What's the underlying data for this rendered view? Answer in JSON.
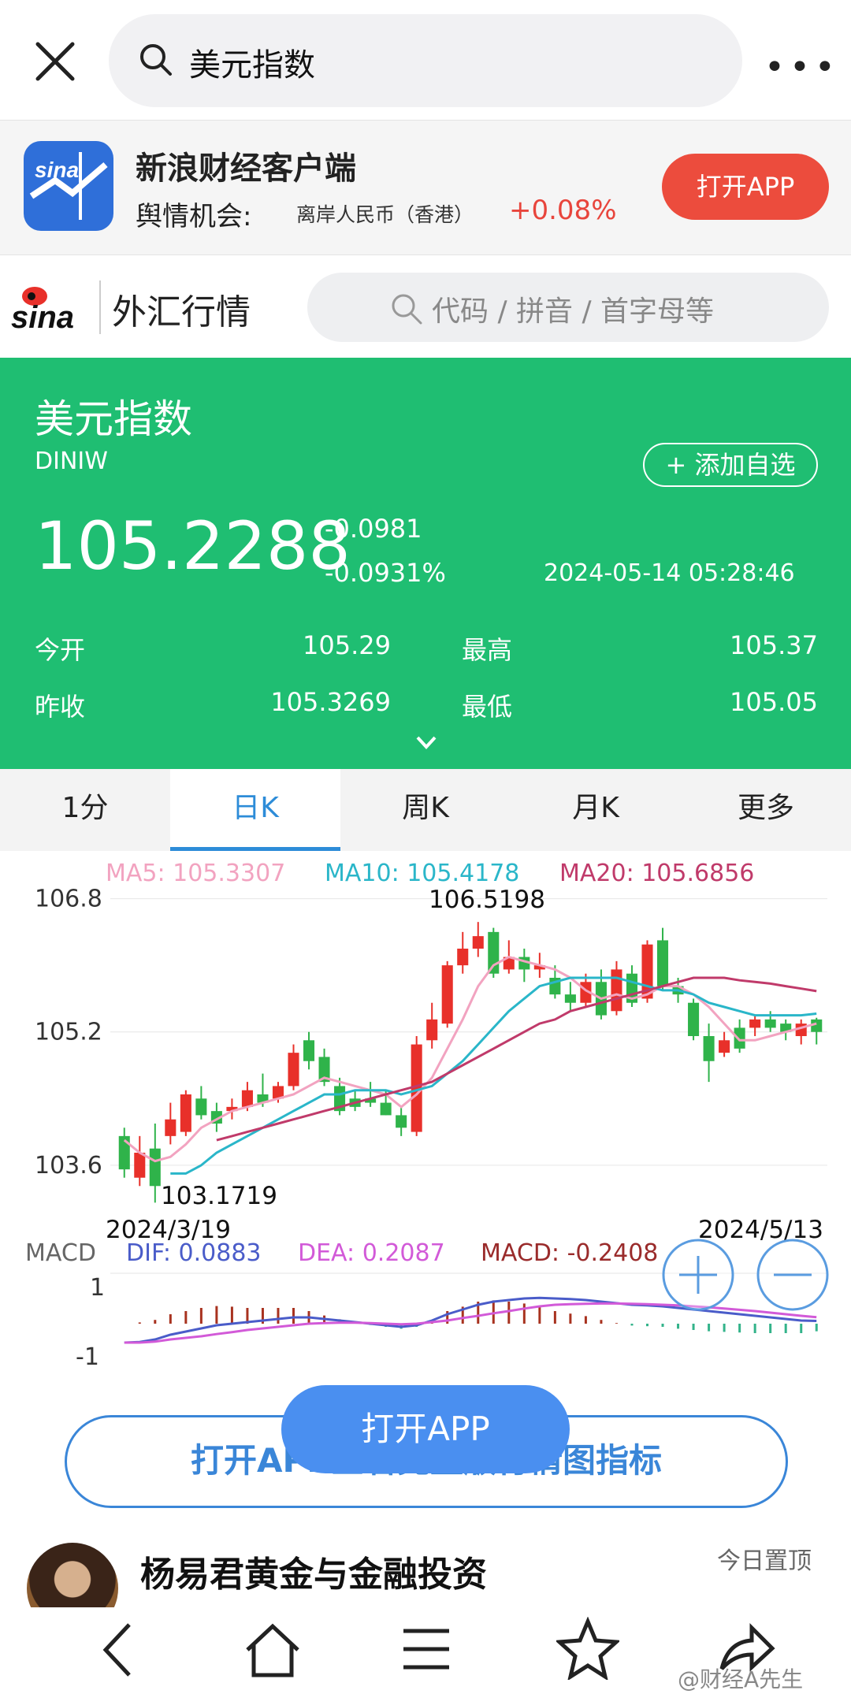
{
  "search": {
    "query": "美元指数"
  },
  "promo": {
    "app_name": "新浪财经客户端",
    "line1": "舆情机会:",
    "line2": "离岸人民币（香港）",
    "line3": "+0.08%",
    "open_label": "打开APP"
  },
  "sina": {
    "section": "外汇行情",
    "search_placeholder": "代码 / 拼音 / 首字母等",
    "logo_text": "sina"
  },
  "quote": {
    "name": "美元指数",
    "code": "DINIW",
    "add_label": "+ 添加自选",
    "price": "105.2288",
    "change": "-0.0981",
    "change_pct": "-0.0931%",
    "time": "2024-05-14 05:28:46",
    "open_label": "今开",
    "open_value": "105.29",
    "high_label": "最高",
    "high_value": "105.37",
    "prev_label": "昨收",
    "prev_value": "105.3269",
    "low_label": "最低",
    "low_value": "105.05"
  },
  "tabs": [
    "1分",
    "日K",
    "周K",
    "月K",
    "更多"
  ],
  "chart_data": {
    "type": "candlestick",
    "ma_labels": {
      "ma5": "MA5: 105.3307",
      "ma10": "MA10: 105.4178",
      "ma20": "MA20: 105.6856"
    },
    "y_ticks": [
      "106.8",
      "105.2",
      "103.6"
    ],
    "ylim": [
      103.4,
      106.9
    ],
    "high_label": "106.5198",
    "low_label": "103.1719",
    "start_date": "2024/3/19",
    "end_date": "2024/5/13",
    "candles": [
      [
        103.95,
        103.55,
        104.05,
        103.45
      ],
      [
        103.45,
        103.75,
        103.95,
        103.35
      ],
      [
        103.8,
        103.35,
        104.1,
        103.15
      ],
      [
        103.95,
        104.15,
        104.35,
        103.85
      ],
      [
        104.0,
        104.45,
        104.5,
        103.95
      ],
      [
        104.4,
        104.2,
        104.55,
        104.15
      ],
      [
        104.25,
        104.1,
        104.35,
        104.0
      ],
      [
        104.25,
        104.3,
        104.4,
        104.15
      ],
      [
        104.3,
        104.5,
        104.6,
        104.25
      ],
      [
        104.45,
        104.35,
        104.7,
        104.3
      ],
      [
        104.4,
        104.55,
        104.6,
        104.35
      ],
      [
        104.55,
        104.95,
        105.05,
        104.5
      ],
      [
        105.1,
        104.85,
        105.2,
        104.75
      ],
      [
        104.9,
        104.6,
        105.0,
        104.55
      ],
      [
        104.55,
        104.25,
        104.65,
        104.2
      ],
      [
        104.4,
        104.3,
        104.5,
        104.25
      ],
      [
        104.4,
        104.35,
        104.6,
        104.3
      ],
      [
        104.35,
        104.2,
        104.5,
        104.2
      ],
      [
        104.2,
        104.05,
        104.3,
        103.95
      ],
      [
        104.0,
        105.05,
        105.15,
        103.95
      ],
      [
        105.1,
        105.35,
        105.55,
        105.0
      ],
      [
        105.3,
        106.0,
        106.05,
        105.25
      ],
      [
        106.0,
        106.2,
        106.4,
        105.9
      ],
      [
        106.2,
        106.35,
        106.52,
        106.1
      ],
      [
        106.4,
        105.9,
        106.45,
        105.85
      ],
      [
        105.95,
        106.1,
        106.3,
        105.9
      ],
      [
        106.1,
        105.95,
        106.2,
        105.8
      ],
      [
        105.95,
        106.0,
        106.15,
        105.85
      ],
      [
        105.85,
        105.65,
        106.0,
        105.6
      ],
      [
        105.65,
        105.55,
        105.8,
        105.45
      ],
      [
        105.55,
        105.8,
        105.9,
        105.5
      ],
      [
        105.8,
        105.4,
        105.95,
        105.35
      ],
      [
        105.45,
        105.95,
        106.05,
        105.4
      ],
      [
        105.9,
        105.55,
        106.0,
        105.5
      ],
      [
        105.6,
        106.25,
        106.3,
        105.55
      ],
      [
        106.3,
        105.75,
        106.45,
        105.7
      ],
      [
        105.75,
        105.65,
        105.85,
        105.55
      ],
      [
        105.55,
        105.15,
        105.6,
        105.1
      ],
      [
        105.15,
        104.85,
        105.3,
        104.6
      ],
      [
        104.95,
        105.1,
        105.2,
        104.9
      ],
      [
        105.25,
        105.0,
        105.35,
        104.95
      ],
      [
        105.25,
        105.35,
        105.4,
        105.15
      ],
      [
        105.35,
        105.25,
        105.45,
        105.2
      ],
      [
        105.3,
        105.2,
        105.35,
        105.1
      ],
      [
        105.15,
        105.3,
        105.35,
        105.05
      ],
      [
        105.35,
        105.2,
        105.37,
        105.05
      ]
    ],
    "ma5": [
      103.9,
      103.75,
      103.65,
      103.7,
      103.85,
      104.05,
      104.15,
      104.25,
      104.3,
      104.35,
      104.4,
      104.45,
      104.55,
      104.65,
      104.6,
      104.55,
      104.5,
      104.45,
      104.3,
      104.45,
      104.65,
      105.0,
      105.35,
      105.75,
      106.0,
      106.1,
      106.05,
      106.0,
      105.95,
      105.85,
      105.7,
      105.6,
      105.65,
      105.6,
      105.65,
      105.75,
      105.75,
      105.65,
      105.5,
      105.3,
      105.1,
      105.1,
      105.15,
      105.2,
      105.25,
      105.3
    ],
    "ma10": [
      null,
      null,
      null,
      103.5,
      103.5,
      103.6,
      103.75,
      103.85,
      103.95,
      104.05,
      104.15,
      104.25,
      104.35,
      104.45,
      104.45,
      104.5,
      104.5,
      104.5,
      104.45,
      104.5,
      104.55,
      104.7,
      104.85,
      105.05,
      105.25,
      105.45,
      105.6,
      105.75,
      105.8,
      105.85,
      105.85,
      105.85,
      105.85,
      105.8,
      105.75,
      105.7,
      105.7,
      105.65,
      105.55,
      105.5,
      105.45,
      105.4,
      105.4,
      105.4,
      105.4,
      105.42
    ],
    "ma20": [
      null,
      null,
      null,
      null,
      null,
      null,
      103.9,
      103.95,
      104.0,
      104.05,
      104.1,
      104.15,
      104.2,
      104.25,
      104.3,
      104.35,
      104.4,
      104.45,
      104.5,
      104.55,
      104.6,
      104.7,
      104.8,
      104.9,
      105.0,
      105.1,
      105.2,
      105.3,
      105.35,
      105.45,
      105.5,
      105.55,
      105.6,
      105.65,
      105.7,
      105.75,
      105.8,
      105.85,
      105.85,
      105.85,
      105.82,
      105.8,
      105.78,
      105.75,
      105.72,
      105.69
    ],
    "macd": {
      "dif_label": "DIF: 0.0883",
      "dea_label": "DEA: 0.2087",
      "macd_label": "MACD: -0.2408",
      "title": "MACD",
      "y_ticks": [
        "1",
        "-1"
      ],
      "ylim": [
        -1.5,
        1.5
      ],
      "dif": [
        -0.6,
        -0.58,
        -0.5,
        -0.35,
        -0.25,
        -0.15,
        -0.05,
        0.0,
        0.05,
        0.1,
        0.15,
        0.2,
        0.2,
        0.15,
        0.1,
        0.05,
        0.0,
        -0.05,
        -0.1,
        -0.05,
        0.1,
        0.3,
        0.45,
        0.6,
        0.7,
        0.75,
        0.8,
        0.82,
        0.8,
        0.78,
        0.75,
        0.7,
        0.65,
        0.6,
        0.58,
        0.55,
        0.5,
        0.45,
        0.4,
        0.35,
        0.3,
        0.25,
        0.2,
        0.15,
        0.1,
        0.0883
      ],
      "dea": [
        -0.6,
        -0.6,
        -0.57,
        -0.5,
        -0.45,
        -0.4,
        -0.33,
        -0.27,
        -0.2,
        -0.15,
        -0.1,
        -0.05,
        0.0,
        0.02,
        0.03,
        0.03,
        0.02,
        0.0,
        -0.02,
        0.0,
        0.05,
        0.1,
        0.18,
        0.25,
        0.33,
        0.4,
        0.48,
        0.55,
        0.6,
        0.62,
        0.63,
        0.64,
        0.64,
        0.63,
        0.62,
        0.6,
        0.58,
        0.55,
        0.52,
        0.48,
        0.44,
        0.4,
        0.35,
        0.3,
        0.25,
        0.2087
      ],
      "bars": [
        0.0,
        0.04,
        0.12,
        0.3,
        0.4,
        0.5,
        0.56,
        0.54,
        0.5,
        0.5,
        0.5,
        0.5,
        0.4,
        0.26,
        0.14,
        0.04,
        -0.04,
        -0.1,
        -0.16,
        -0.1,
        0.1,
        0.4,
        0.54,
        0.7,
        0.74,
        0.7,
        0.64,
        0.54,
        0.4,
        0.32,
        0.24,
        0.12,
        0.02,
        -0.06,
        -0.08,
        -0.1,
        -0.16,
        -0.2,
        -0.24,
        -0.26,
        -0.28,
        -0.3,
        -0.3,
        -0.3,
        -0.3,
        -0.2408
      ]
    }
  },
  "chart_colors": {
    "up": "#e8302a",
    "down": "#2fb34a",
    "ma5": "#f2a3c0",
    "ma10": "#2ab6c9",
    "ma20": "#c03a6a",
    "dif": "#4a5cc9",
    "dea": "#d25ad8",
    "macd_label": "#9a2b2b"
  },
  "cta": {
    "big_label": "打开APP查看完整版行情图指标",
    "float_label": "打开APP"
  },
  "author": {
    "name": "杨易君黄金与金融投资",
    "pin": "今日置顶"
  },
  "watermark": "@财经A先生"
}
